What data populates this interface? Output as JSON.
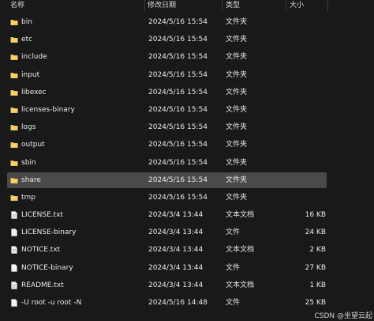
{
  "columns": {
    "name": "名称",
    "date": "修改日期",
    "type": "类型",
    "size": "大小"
  },
  "files": [
    {
      "name": "bin",
      "date": "2024/5/16 15:54",
      "type": "文件夹",
      "size": "",
      "icon": "folder-icon",
      "selected": false
    },
    {
      "name": "etc",
      "date": "2024/5/16 15:54",
      "type": "文件夹",
      "size": "",
      "icon": "folder-icon",
      "selected": false
    },
    {
      "name": "include",
      "date": "2024/5/16 15:54",
      "type": "文件夹",
      "size": "",
      "icon": "folder-icon",
      "selected": false
    },
    {
      "name": "input",
      "date": "2024/5/16 15:54",
      "type": "文件夹",
      "size": "",
      "icon": "folder-icon",
      "selected": false
    },
    {
      "name": "libexec",
      "date": "2024/5/16 15:54",
      "type": "文件夹",
      "size": "",
      "icon": "folder-icon",
      "selected": false
    },
    {
      "name": "licenses-binary",
      "date": "2024/5/16 15:54",
      "type": "文件夹",
      "size": "",
      "icon": "folder-icon",
      "selected": false
    },
    {
      "name": "logs",
      "date": "2024/5/16 15:54",
      "type": "文件夹",
      "size": "",
      "icon": "folder-icon",
      "selected": false
    },
    {
      "name": "output",
      "date": "2024/5/16 15:54",
      "type": "文件夹",
      "size": "",
      "icon": "folder-icon",
      "selected": false
    },
    {
      "name": "sbin",
      "date": "2024/5/16 15:54",
      "type": "文件夹",
      "size": "",
      "icon": "folder-icon",
      "selected": false
    },
    {
      "name": "share",
      "date": "2024/5/16 15:54",
      "type": "文件夹",
      "size": "",
      "icon": "folder-icon",
      "selected": true
    },
    {
      "name": "tmp",
      "date": "2024/5/16 15:54",
      "type": "文件夹",
      "size": "",
      "icon": "folder-icon",
      "selected": false
    },
    {
      "name": "LICENSE.txt",
      "date": "2024/3/4 13:44",
      "type": "文本文档",
      "size": "16 KB",
      "icon": "text-file-icon",
      "selected": false
    },
    {
      "name": "LICENSE-binary",
      "date": "2024/3/4 13:44",
      "type": "文件",
      "size": "24 KB",
      "icon": "file-icon",
      "selected": false
    },
    {
      "name": "NOTICE.txt",
      "date": "2024/3/4 13:44",
      "type": "文本文档",
      "size": "2 KB",
      "icon": "text-file-icon",
      "selected": false
    },
    {
      "name": "NOTICE-binary",
      "date": "2024/3/4 13:44",
      "type": "文件",
      "size": "27 KB",
      "icon": "file-icon",
      "selected": false
    },
    {
      "name": "README.txt",
      "date": "2024/3/4 13:44",
      "type": "文本文档",
      "size": "1 KB",
      "icon": "text-file-icon",
      "selected": false
    },
    {
      "name": "-U root -u root -N",
      "date": "2024/5/16 14:48",
      "type": "文件",
      "size": "25 KB",
      "icon": "file-icon",
      "selected": false
    }
  ],
  "watermark": "CSDN @坐望云起",
  "colors": {
    "background": "#191919",
    "selected_row": "#4a4a4a",
    "folder": "#f2c14e",
    "text": "#e9e9e9"
  }
}
